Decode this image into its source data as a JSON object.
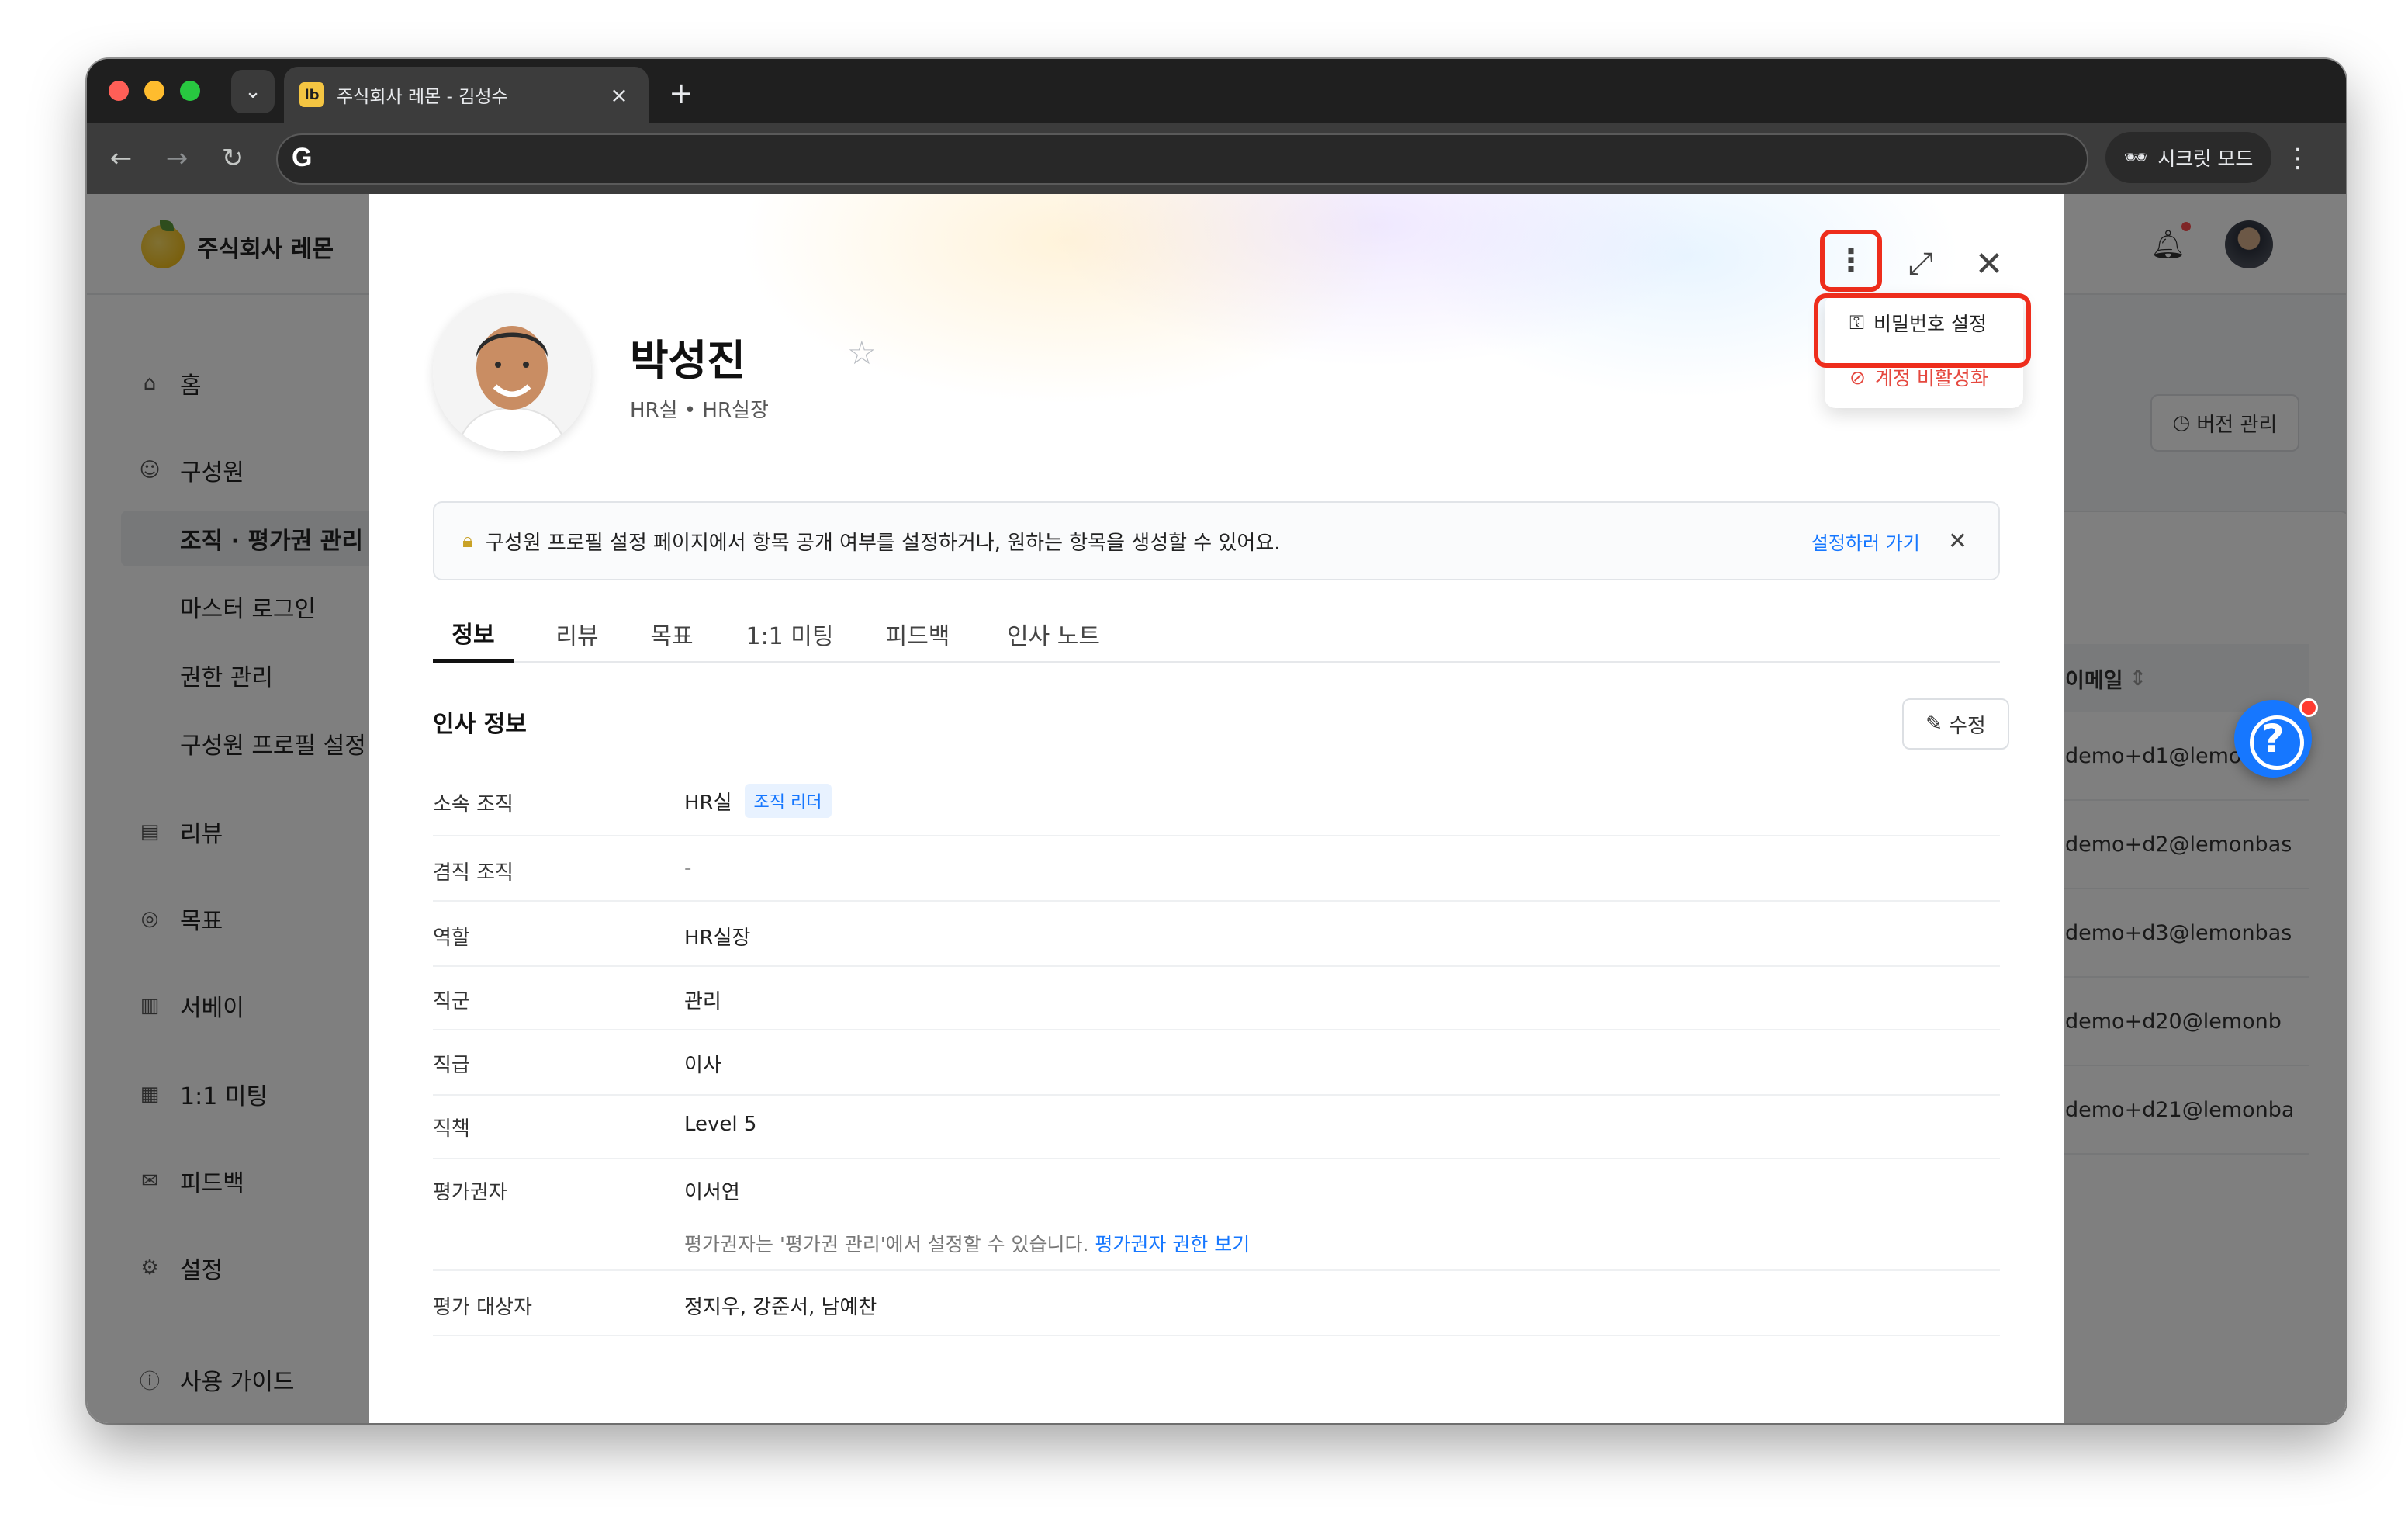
{
  "browser": {
    "tab_title": "주식회사 레몬 - 김성수",
    "tab_favicon": "lb",
    "incognito_label": "시크릿 모드"
  },
  "app": {
    "company_name": "주식회사 레몬",
    "version_button": "버전 관리",
    "sidebar": {
      "items": [
        {
          "label": "홈",
          "icon": "home-icon"
        },
        {
          "label": "구성원",
          "icon": "user-icon"
        },
        {
          "label": "조직 · 평가권 관리"
        },
        {
          "label": "마스터 로그인"
        },
        {
          "label": "권한 관리"
        },
        {
          "label": "구성원 프로필 설정"
        },
        {
          "label": "리뷰",
          "icon": "document-icon"
        },
        {
          "label": "목표",
          "icon": "target-icon"
        },
        {
          "label": "서베이",
          "icon": "chart-icon"
        },
        {
          "label": "1:1 미팅",
          "icon": "calendar-icon"
        },
        {
          "label": "피드백",
          "icon": "mail-icon"
        },
        {
          "label": "설정",
          "icon": "gear-icon"
        },
        {
          "label": "사용 가이드",
          "icon": "help-icon"
        }
      ]
    },
    "table": {
      "email_header": "이메일",
      "emails": [
        "demo+d1@lemonbase",
        "demo+d2@lemonbas",
        "demo+d3@lemonbas",
        "demo+d20@lemonb",
        "demo+d21@lemonba"
      ]
    }
  },
  "drawer": {
    "name": "박성진",
    "subtitle": "HR실 • HR실장",
    "menu": {
      "set_password": "비밀번호 설정",
      "deactivate": "계정 비활성화"
    },
    "notice": {
      "text": "구성원 프로필 설정 페이지에서 항목 공개 여부를 설정하거나, 원하는 항목을 생성할 수 있어요.",
      "link": "설정하러 가기"
    },
    "tabs": [
      "정보",
      "리뷰",
      "목표",
      "1:1 미팅",
      "피드백",
      "인사 노트"
    ],
    "section_title": "인사 정보",
    "edit_button": "수정",
    "rows": {
      "org": {
        "label": "소속 조직",
        "value": "HR실",
        "badge": "조직 리더"
      },
      "concurrent": {
        "label": "겸직 조직",
        "value": "-"
      },
      "role": {
        "label": "역할",
        "value": "HR실장"
      },
      "job_group": {
        "label": "직군",
        "value": "관리"
      },
      "rank": {
        "label": "직급",
        "value": "이사"
      },
      "duty": {
        "label": "직책",
        "value": "Level 5"
      },
      "evaluator": {
        "label": "평가권자",
        "value": "이서연",
        "hint": "평가권자는 '평가권 관리'에서 설정할 수 있습니다.",
        "hint_link": "평가권자 권한 보기"
      },
      "targets": {
        "label": "평가 대상자",
        "value": "정지우, 강준서, 남예찬"
      }
    }
  },
  "colors": {
    "accent": "#1677ff",
    "highlight": "#ee2d1c",
    "danger": "#e5483f"
  }
}
